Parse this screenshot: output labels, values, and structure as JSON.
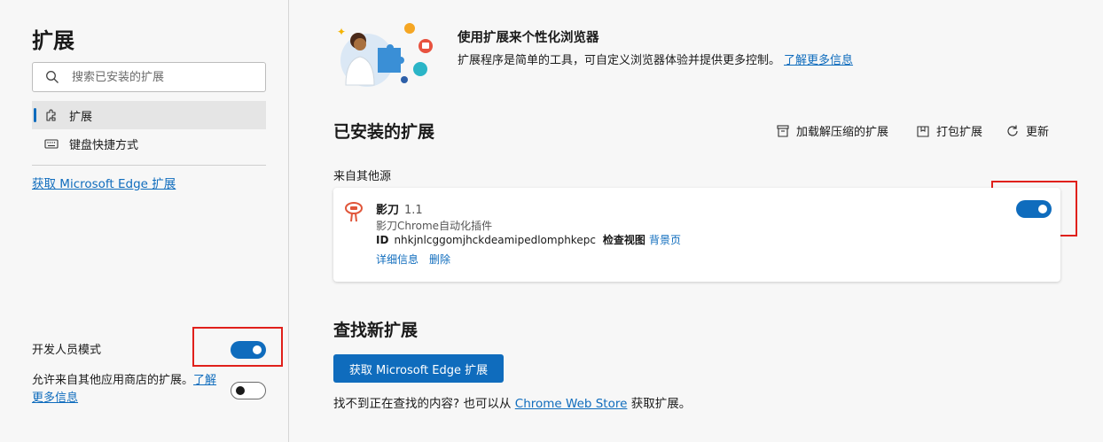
{
  "sidebar": {
    "title": "扩展",
    "search_placeholder": "搜索已安装的扩展",
    "nav": [
      {
        "label": "扩展",
        "active": true
      },
      {
        "label": "键盘快捷方式",
        "active": false
      }
    ],
    "get_link": "获取 Microsoft Edge 扩展",
    "dev_mode_label": "开发人员模式",
    "dev_mode_on": true,
    "allow_other_label": "允许来自其他应用商店的扩展。",
    "allow_other_link": "了解更多信息",
    "allow_other_on": false
  },
  "hero": {
    "title": "使用扩展来个性化浏览器",
    "desc": "扩展程序是简单的工具，可自定义浏览器体验并提供更多控制。",
    "link": "了解更多信息"
  },
  "installed": {
    "title": "已安装的扩展",
    "actions": {
      "load_unpacked": "加载解压缩的扩展",
      "pack": "打包扩展",
      "update": "更新"
    },
    "source_label": "来自其他源",
    "extension": {
      "name": "影刀",
      "version": "1.1",
      "description": "影刀Chrome自动化插件",
      "id_label": "ID",
      "id": "nhkjnlcggomjhckdeamipedlomphkepc",
      "inspect_label": "检查视图",
      "inspect_link": "背景页",
      "details": "详细信息",
      "remove": "删除",
      "enabled": true
    }
  },
  "find": {
    "title": "查找新扩展",
    "button": "获取 Microsoft Edge 扩展",
    "text_before": "找不到正在查找的内容? 也可以从",
    "store_link": "Chrome Web Store",
    "text_after": "获取扩展。"
  },
  "colors": {
    "accent": "#0f6cbd",
    "highlight": "#e0201b"
  }
}
